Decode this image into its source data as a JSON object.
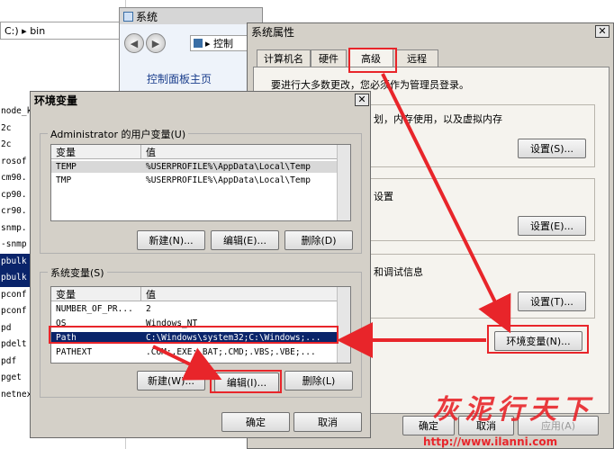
{
  "explorer": {
    "address": "C:) ▸ bin",
    "files": [
      "node_k",
      "2c",
      "2c",
      "rosof",
      "cm90.",
      "cp90.",
      "cr90.",
      "snmp.",
      "-snmp",
      "pbulk",
      "pbulk",
      "pconf",
      "pconf",
      "pd",
      "pdelt",
      "pdf",
      "pget",
      "netnext"
    ]
  },
  "system_window": {
    "title": "系统",
    "breadcrumb": "▸ 控制",
    "home_link": "控制面板主页"
  },
  "sysprops": {
    "title": "系统属性",
    "tabs": [
      "计算机名",
      "硬件",
      "高级",
      "远程"
    ],
    "admin_note": "要进行大多数更改，您必须作为管理员登录。",
    "perf_text": "划，内存使用，以及虚拟内存",
    "profile_text": "设置",
    "startup_text": "和调试信息",
    "settings_s": "设置(S)...",
    "settings_e": "设置(E)...",
    "settings_t": "设置(T)...",
    "env_button": "环境变量(N)...",
    "ok": "确定",
    "cancel": "取消",
    "apply": "应用(A)"
  },
  "envvars": {
    "title": "环境变量",
    "user_group": "Administrator 的用户变量(U)",
    "col_var": "变量",
    "col_val": "值",
    "user_rows": [
      {
        "name": "TEMP",
        "value": "%USERPROFILE%\\AppData\\Local\\Temp"
      },
      {
        "name": "TMP",
        "value": "%USERPROFILE%\\AppData\\Local\\Temp"
      }
    ],
    "user_new": "新建(N)...",
    "user_edit": "编辑(E)...",
    "user_delete": "删除(D)",
    "sys_group": "系统变量(S)",
    "sys_rows": [
      {
        "name": "NUMBER_OF_PR...",
        "value": "2"
      },
      {
        "name": "OS",
        "value": "Windows_NT"
      },
      {
        "name": "Path",
        "value": "C:\\Windows\\system32;C:\\Windows;..."
      },
      {
        "name": "PATHEXT",
        "value": ".COM;.EXE;.BAT;.CMD;.VBS;.VBE;..."
      }
    ],
    "sys_new": "新建(W)...",
    "sys_edit": "编辑(I)...",
    "sys_delete": "删除(L)",
    "ok": "确定",
    "cancel": "取消"
  },
  "watermark": {
    "brand": "灰泥行天下",
    "url": "http://www.ilanni.com"
  }
}
